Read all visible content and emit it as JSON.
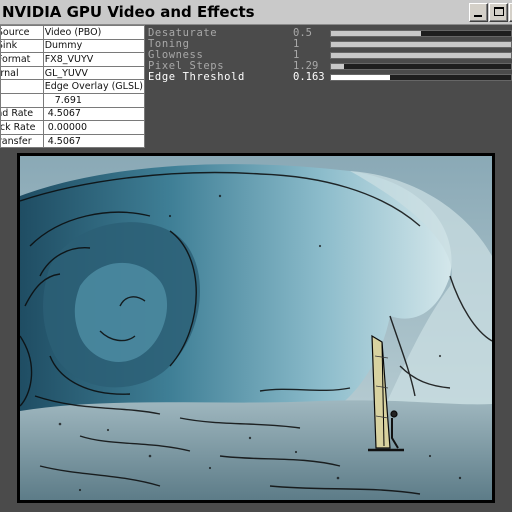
{
  "window": {
    "title": "NVIDIA GPU Video and Effects",
    "controls": {
      "minimize": "minimize-icon",
      "maximize": "maximize-icon",
      "close": "close-icon"
    }
  },
  "info_table": [
    {
      "key": "ge Source",
      "value": "Video (PBO)"
    },
    {
      "key": "ge Sink",
      "value": "Dummy"
    },
    {
      "key": "ge Format",
      "value": "FX8_VUYV"
    },
    {
      "key": "Internal",
      "value": "GL_YUVV"
    },
    {
      "key": "der",
      "value": "Edge Overlay (GLSL)"
    },
    {
      "key": "S",
      "value": "7.691"
    },
    {
      "key": "nload Rate",
      "value": "4.5067"
    },
    {
      "key": "dback Rate",
      "value": "0.00000"
    },
    {
      "key": "al Transfer",
      "value": "4.5067"
    }
  ],
  "params": [
    {
      "label": "Desaturate",
      "value": "0.5",
      "level": 0.5,
      "active": false
    },
    {
      "label": "Toning",
      "value": "1",
      "level": 1.0,
      "active": false
    },
    {
      "label": "Glowness",
      "value": "1",
      "level": 1.0,
      "active": false
    },
    {
      "label": "Pixel Steps",
      "value": "1.29",
      "level": 0.07,
      "active": false
    },
    {
      "label": "Edge Threshold",
      "value": "0.163",
      "level": 0.33,
      "active": true
    }
  ],
  "colors": {
    "titlebar": "#c9c9c9",
    "background": "#4b4b4b",
    "param_text": "#a8a8a8",
    "active_text": "#ffffff"
  }
}
